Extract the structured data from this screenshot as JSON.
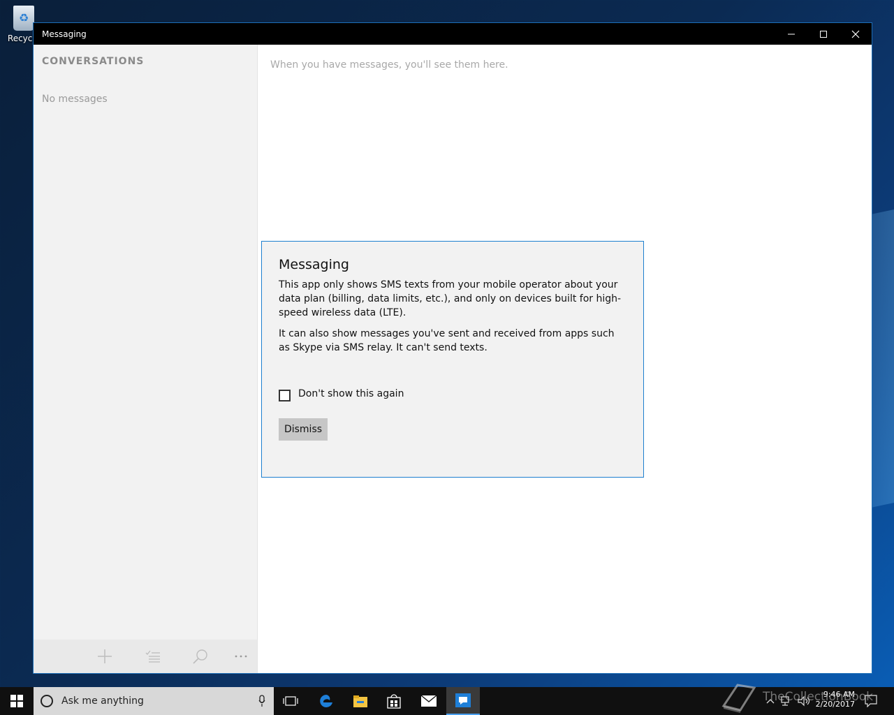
{
  "desktop": {
    "recycle_bin_label": "Recycle"
  },
  "window": {
    "title": "Messaging",
    "controls": [
      "minimize-icon",
      "maximize-icon",
      "close-icon"
    ]
  },
  "sidebar": {
    "heading": "CONVERSATIONS",
    "empty_text": "No messages",
    "appbar_icons": [
      "add-icon",
      "select-icon",
      "search-icon",
      "more-icon"
    ]
  },
  "main": {
    "hint": "When you have messages, you'll see them here."
  },
  "dialog": {
    "title": "Messaging",
    "paragraph1": "This app only shows SMS texts from your mobile operator about your data plan (billing, data limits, etc.), and only on devices built for high-speed wireless data (LTE).",
    "paragraph2": "It can also show messages you've sent and received from apps such as Skype via SMS relay. It can't send texts.",
    "checkbox_label": "Don't show this again",
    "checkbox_checked": false,
    "dismiss_label": "Dismiss"
  },
  "taskbar": {
    "search_placeholder": "Ask me anything",
    "apps": [
      "task-view-icon",
      "edge-icon",
      "file-explorer-icon",
      "store-icon",
      "mail-icon",
      "messaging-icon"
    ],
    "active_app": "messaging-icon",
    "time": "9:46 AM",
    "date": "2/20/2017"
  },
  "watermark": {
    "text": "TheCollectionBook"
  },
  "colors": {
    "accent": "#1d7fcf",
    "titlebar": "#000000",
    "taskbar": "#101010"
  }
}
